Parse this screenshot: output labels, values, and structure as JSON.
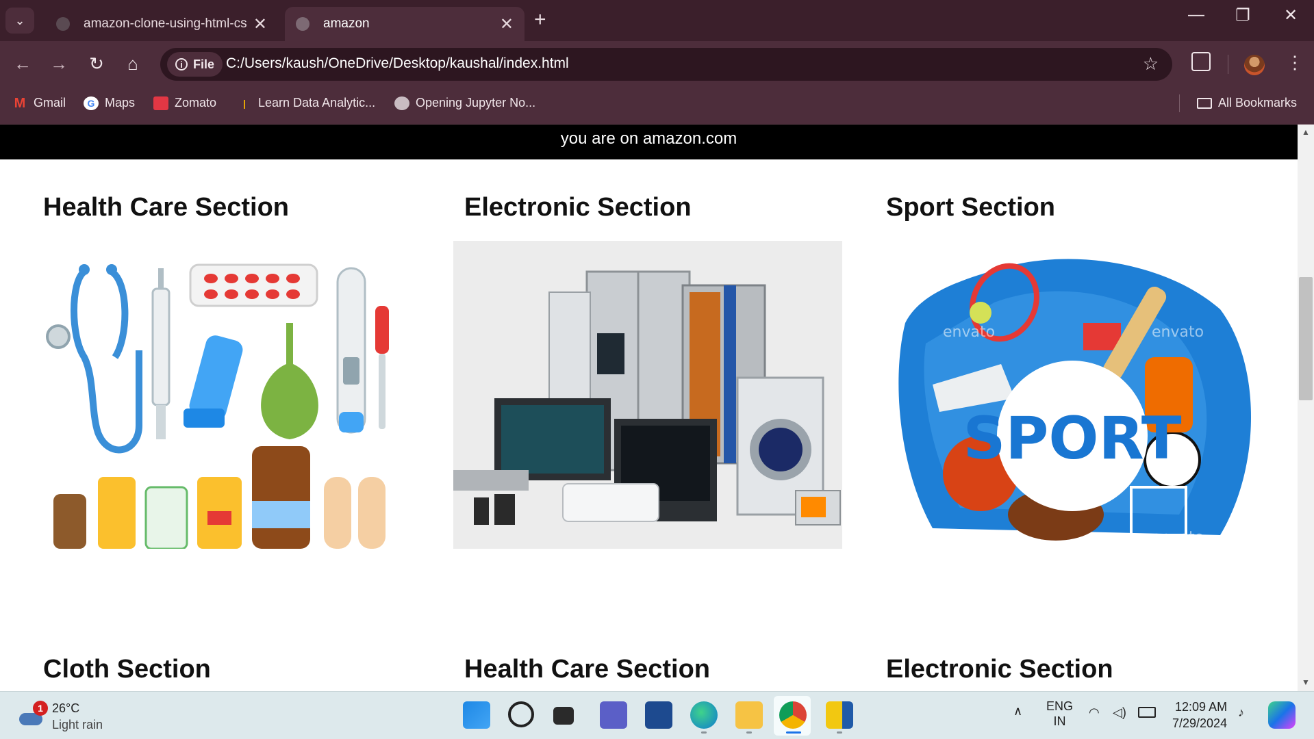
{
  "browser": {
    "tabs": [
      {
        "title": "amazon-clone-using-html-css/s",
        "active": false
      },
      {
        "title": "amazon",
        "active": true
      }
    ],
    "new_tab_label": "+",
    "address": {
      "chip_label": "File",
      "url": "C:/Users/kaush/OneDrive/Desktop/kaushal/index.html"
    },
    "bookmarks": [
      {
        "label": "Gmail",
        "icon": "gmail-icon"
      },
      {
        "label": "Maps",
        "icon": "google-maps-icon"
      },
      {
        "label": "Zomato",
        "icon": "zomato-icon"
      },
      {
        "label": "Learn Data Analytic...",
        "icon": "bookmark-site-icon"
      },
      {
        "label": "Opening Jupyter No...",
        "icon": "globe-icon"
      }
    ],
    "all_bookmarks_label": "All Bookmarks"
  },
  "page": {
    "banner": "you are on amazon.com",
    "sections_row1": [
      {
        "title": "Health Care Section",
        "image": "medical-supplies-illustration"
      },
      {
        "title": "Electronic Section",
        "image": "home-appliances-photo"
      },
      {
        "title": "Sport Section",
        "image": "sport-equipment-illustration"
      }
    ],
    "sections_row2": [
      {
        "title": "Cloth Section"
      },
      {
        "title": "Health Care Section"
      },
      {
        "title": "Electronic Section"
      }
    ],
    "sport_image_text": "SPORT",
    "watermark_text": "envato"
  },
  "taskbar": {
    "weather": {
      "temp": "26°C",
      "condition": "Light rain",
      "badge": "1"
    },
    "language": {
      "line1": "ENG",
      "line2": "IN"
    },
    "clock": {
      "time": "12:09 AM",
      "date": "7/29/2024"
    }
  },
  "colors": {
    "tabbar": "#3b1f2b",
    "toolbar": "#4d2d3b",
    "banner": "#000000",
    "taskbar": "#dde9ec"
  }
}
